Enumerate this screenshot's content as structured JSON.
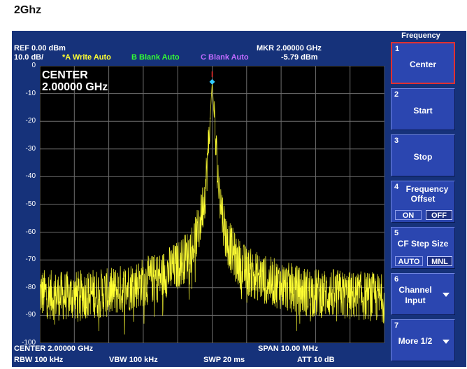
{
  "page": {
    "title": "2Ghz"
  },
  "header": {
    "ref": "REF  0.00 dBm",
    "scale": "10.0 dB/",
    "trace_a": "*A Write Auto",
    "trace_b": "B Blank Auto",
    "trace_c": "C Blank Auto",
    "marker_freq": "MKR 2.00000 GHz",
    "marker_level": "-5.79 dBm"
  },
  "screen": {
    "center_label": "CENTER",
    "center_value": "2.00000 GHz",
    "y_axis_labels": [
      "0",
      "-10",
      "-20",
      "-30",
      "-40",
      "-50",
      "-60",
      "-70",
      "-80",
      "-90",
      "-100"
    ]
  },
  "footer": {
    "center": "CENTER 2.00000 GHz",
    "span": "SPAN 10.00 MHz",
    "rbw": "RBW  100 kHz",
    "vbw": "VBW  100 kHz",
    "swp": "SWP  20 ms",
    "att": "ATT  10 dB"
  },
  "softkey_panel": {
    "title": "Frequency",
    "keys": [
      {
        "num": "1",
        "label": "Center",
        "selected": true
      },
      {
        "num": "2",
        "label": "Start"
      },
      {
        "num": "3",
        "label": "Stop"
      },
      {
        "num": "4",
        "label_line1": "Frequency",
        "label_line2": "Offset",
        "opt_on": "ON",
        "opt_off": "OFF",
        "active": "OFF"
      },
      {
        "num": "5",
        "label": "CF Step Size",
        "opt_auto": "AUTO",
        "opt_mnl": "MNL",
        "active": "MNL"
      },
      {
        "num": "6",
        "label_line1": "Channel",
        "label_line2": "Input"
      },
      {
        "num": "7",
        "label": "More 1/2"
      }
    ]
  },
  "colors": {
    "frame": "#16327a",
    "screen_bg": "#000000",
    "trace": "#ffff33",
    "grid": "#6e6e6e",
    "marker": "#33ccff"
  },
  "chart_data": {
    "type": "line",
    "x_unit": "MHz",
    "y_unit": "dBm",
    "xlim": [
      1995.0,
      2005.0
    ],
    "ylim": [
      -100,
      0
    ],
    "center_mhz": 2000.0,
    "span_mhz": 10.0,
    "ref_level_dbm": 0.0,
    "scale_db_per_div": 10.0,
    "grid": true,
    "marker": {
      "x": 2000.0,
      "y": -5.79
    },
    "series": [
      {
        "x": [
          1995.0,
          1995.5,
          1996.0,
          1996.5,
          1997.0,
          1997.5,
          1998.0,
          1998.5,
          1999.0,
          1999.3,
          1999.6,
          1999.8,
          1999.9,
          2000.0,
          2000.1,
          2000.2,
          2000.4,
          2000.7,
          2001.0,
          2001.5,
          2002.0,
          2002.5,
          2003.0,
          2003.5,
          2004.0,
          2004.5,
          2005.0
        ],
        "y": [
          -82,
          -83,
          -83,
          -82,
          -82,
          -80,
          -78,
          -76,
          -72,
          -68,
          -60,
          -45,
          -28,
          -5.79,
          -28,
          -45,
          -62,
          -70,
          -74,
          -77,
          -79,
          -81,
          -82,
          -82,
          -83,
          -83,
          -84
        ]
      }
    ]
  }
}
